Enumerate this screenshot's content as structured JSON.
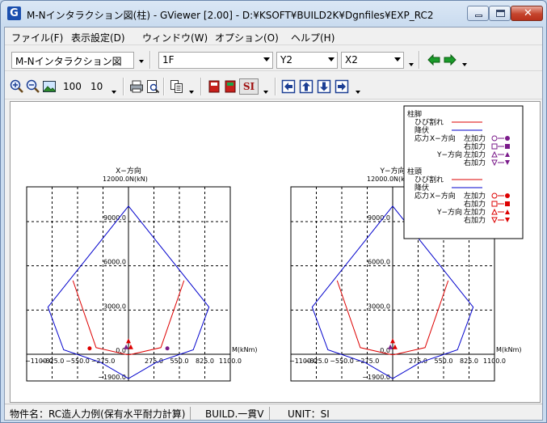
{
  "window": {
    "title": "M-Nインタラクション図(柱) - GViewer [2.00] - D:¥KSOFT¥BUILD2K¥Dgnfiles¥EXP_RC2",
    "app_icon": "G"
  },
  "menu": [
    "ファイル(F)",
    "表示設定(D)",
    "ウィンドウ(W)",
    "オプション(O)",
    "ヘルプ(H)"
  ],
  "toolbar1": {
    "view_select": "M-Nインタラクション図",
    "floor": "1F",
    "y_axis": "Y2",
    "x_axis": "X2",
    "icons": [
      "arrow-left-icon",
      "arrow-right-icon"
    ]
  },
  "toolbar2": {
    "value_a": "100",
    "value_b": "10",
    "unit_label": "SI",
    "icons": [
      "zoom-in-icon",
      "zoom-out-icon",
      "picture-icon",
      "print-icon",
      "print-preview-icon",
      "copy-icon",
      "book-red-icon",
      "book-green-icon",
      "si-icon",
      "arrow-left-box-icon",
      "arrow-up-box-icon",
      "arrow-down-box-icon",
      "arrow-right-box-icon"
    ]
  },
  "legend": {
    "head_foot": "柱脚",
    "crack": "ひび割れ",
    "yield": "降伏",
    "stress": "応力",
    "x_dir": "X−方向",
    "y_dir": "Y−方向",
    "left_force": "左加力",
    "right_force": "右加力",
    "head_top": "柱頭",
    "colors": {
      "crack": "#dd0000",
      "yield": "#0000cc",
      "foot_marker": "#7a1a8a",
      "top_marker": "#dd0000"
    }
  },
  "chart_data": [
    {
      "type": "line",
      "title": "X−方向",
      "ylabel": "N(kN)",
      "ylabel_value": "12000.0",
      "xlabel": "M(kNm)",
      "x_ticks": [
        "−1100.0",
        "−825.0",
        "−550.0",
        "−275.0",
        "0.0",
        "275.0",
        "550.0",
        "825.0",
        "1100.0"
      ],
      "y_ticks": [
        "9000.0",
        "6000.0",
        "3000.0",
        "0.0",
        "−1900.0"
      ],
      "xlim": [
        -1100,
        1100
      ],
      "ylim": [
        -1900,
        12000
      ],
      "series": [
        {
          "name": "降伏",
          "points": [
            [
              0,
              10050
            ],
            [
              -870,
              3200
            ],
            [
              -700,
              300
            ],
            [
              -300,
              -550
            ],
            [
              0,
              -1650
            ],
            [
              300,
              -550
            ],
            [
              700,
              300
            ],
            [
              870,
              3200
            ],
            [
              0,
              10050
            ]
          ]
        },
        {
          "name": "ひび割れ",
          "points": [
            [
              -600,
              5000
            ],
            [
              -350,
              450
            ],
            [
              -20,
              -20
            ],
            [
              20,
              -20
            ],
            [
              350,
              450
            ],
            [
              600,
              5000
            ]
          ]
        }
      ],
      "markers": [
        [
          -420,
          400
        ],
        [
          420,
          400
        ],
        [
          -25,
          450
        ],
        [
          25,
          450
        ],
        [
          0,
          800
        ]
      ]
    },
    {
      "type": "line",
      "title": "Y−方向",
      "ylabel": "N(kN)",
      "ylabel_value": "12000.0",
      "xlabel": "M(kNm)",
      "x_ticks": [
        "−1100.0",
        "−825.0",
        "−550.0",
        "−275.0",
        "0.0",
        "275.0",
        "550.0",
        "825.0",
        "1100.0"
      ],
      "y_ticks": [
        "9000.0",
        "6000.0",
        "3000.0",
        "0.0",
        "−1900.0"
      ],
      "xlim": [
        -1100,
        1100
      ],
      "ylim": [
        -1900,
        12000
      ],
      "series": [
        {
          "name": "降伏",
          "points": [
            [
              0,
              10050
            ],
            [
              -870,
              3200
            ],
            [
              -700,
              300
            ],
            [
              -300,
              -550
            ],
            [
              0,
              -1650
            ],
            [
              300,
              -550
            ],
            [
              700,
              300
            ],
            [
              870,
              3200
            ],
            [
              0,
              10050
            ]
          ]
        },
        {
          "name": "ひび割れ",
          "points": [
            [
              -600,
              5000
            ],
            [
              -350,
              450
            ],
            [
              -20,
              -20
            ],
            [
              20,
              -20
            ],
            [
              350,
              450
            ],
            [
              600,
              5000
            ]
          ]
        }
      ],
      "markers": [
        [
          -25,
          450
        ],
        [
          25,
          450
        ],
        [
          0,
          800
        ]
      ]
    }
  ],
  "status": {
    "project": "物件名：RC造人力例(保有水平耐力計算)",
    "software": "BUILD.一貫Ⅴ",
    "unit": "UNIT：SI"
  }
}
